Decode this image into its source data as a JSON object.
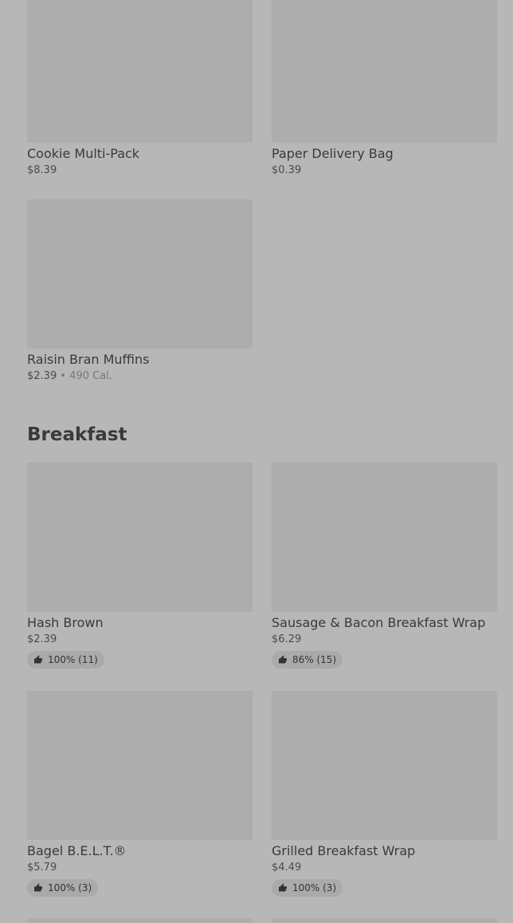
{
  "top_items": [
    {
      "name": "Cookie Multi-Pack",
      "price": "$8.39"
    },
    {
      "name": "Paper Delivery Bag",
      "price": "$0.39"
    },
    {
      "name": "Raisin Bran Muffins",
      "price": "$2.39",
      "separator": "•",
      "calories": "490 Cal."
    }
  ],
  "breakfast": {
    "title": "Breakfast",
    "items": [
      {
        "name": "Hash Brown",
        "price": "$2.39",
        "rating": "100% (11)"
      },
      {
        "name": "Sausage & Bacon Breakfast Wrap",
        "price": "$6.29",
        "rating": "86% (15)"
      },
      {
        "name": "Bagel B.E.L.T.®",
        "price": "$5.79",
        "rating": "100% (3)"
      },
      {
        "name": "Grilled Breakfast Wrap",
        "price": "$4.49",
        "rating": "100% (3)"
      }
    ]
  },
  "icons": {
    "rating": "thumbs-up-icon"
  },
  "colors": {
    "background": "#b7b7b7",
    "placeholder": "#adadad",
    "badge": "#aaaaaa"
  }
}
